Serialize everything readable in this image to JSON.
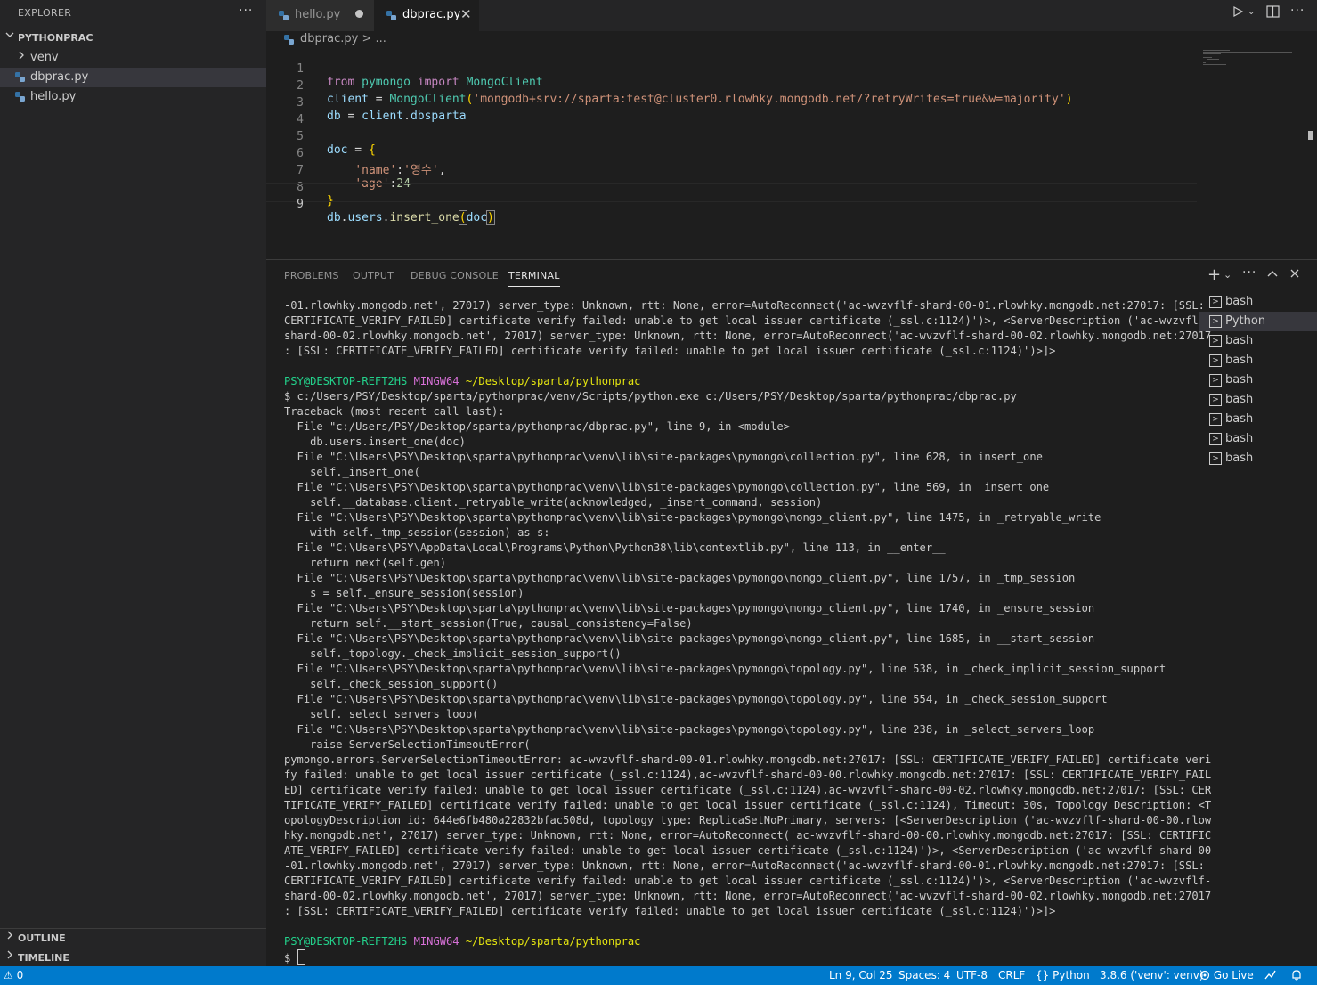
{
  "explorer": {
    "title": "EXPLORER",
    "more": "···",
    "folder": "PYTHONPRAC",
    "items": [
      {
        "label": "venv",
        "type": "folder"
      },
      {
        "label": "dbprac.py",
        "type": "file",
        "active": true
      },
      {
        "label": "hello.py",
        "type": "file"
      }
    ],
    "outline": "OUTLINE",
    "timeline": "TIMELINE"
  },
  "tabs": [
    {
      "label": "hello.py",
      "state": "modified"
    },
    {
      "label": "dbprac.py",
      "state": "active"
    }
  ],
  "breadcrumb": {
    "file": "dbprac.py",
    "rest": "> ..."
  },
  "editor": {
    "line_numbers": [
      "1",
      "2",
      "3",
      "4",
      "5",
      "6",
      "7",
      "8",
      "9"
    ],
    "lines": {
      "l1": {
        "kw1": "from",
        "mod": "pymongo",
        "kw2": "import",
        "cls": "MongoClient"
      },
      "l2": {
        "var": "client",
        "op": " = ",
        "cls": "MongoClient",
        "open": "(",
        "str": "'mongodb+srv://sparta:test@cluster0.rlowhky.mongodb.net/?retryWrites=true&w=majority'",
        "close": ")"
      },
      "l3": {
        "var": "db",
        "op": " = ",
        "v2": "client",
        "dot": ".",
        "attr": "dbsparta"
      },
      "l5": {
        "var": "doc",
        "op": " = ",
        "brace": "{"
      },
      "l6": {
        "key": "'name'",
        "colon": ":",
        "val": "'영수'",
        "comma": ","
      },
      "l7": {
        "key": "'age'",
        "colon": ":",
        "val": "24"
      },
      "l8": {
        "brace": "}"
      },
      "l9": {
        "v1": "db",
        "dot1": ".",
        "v2": "users",
        "dot2": ".",
        "fn": "insert_one",
        "open": "(",
        "arg": "doc",
        "close": ")"
      }
    }
  },
  "panel": {
    "tabs": [
      "PROBLEMS",
      "OUTPUT",
      "DEBUG CONSOLE",
      "TERMINAL"
    ],
    "active_tab": "TERMINAL",
    "actions": {
      "add": "+",
      "chev": "⌄",
      "more": "···",
      "maximize": "^",
      "close": "✕"
    }
  },
  "terminal": {
    "head": [
      "-01.rlowhky.mongodb.net', 27017) server_type: Unknown, rtt: None, error=AutoReconnect('ac-wvzvflf-shard-00-01.rlowhky.mongodb.net:27017: [SSL:",
      "CERTIFICATE_VERIFY_FAILED] certificate verify failed: unable to get local issuer certificate (_ssl.c:1124)')>, <ServerDescription ('ac-wvzvflf-",
      "shard-00-02.rlowhky.mongodb.net', 27017) server_type: Unknown, rtt: None, error=AutoReconnect('ac-wvzvflf-shard-00-02.rlowhky.mongodb.net:27017",
      ": [SSL: CERTIFICATE_VERIFY_FAILED] certificate verify failed: unable to get local issuer certificate (_ssl.c:1124)')>]>"
    ],
    "prompt": {
      "user": "PSY@DESKTOP-REFT2HS",
      "shell": "MINGW64",
      "path": "~/Desktop/sparta/pythonprac"
    },
    "command": "$ c:/Users/PSY/Desktop/sparta/pythonprac/venv/Scripts/python.exe c:/Users/PSY/Desktop/sparta/pythonprac/dbprac.py",
    "trace": [
      "Traceback (most recent call last):",
      "  File \"c:/Users/PSY/Desktop/sparta/pythonprac/dbprac.py\", line 9, in <module>",
      "    db.users.insert_one(doc)",
      "  File \"C:\\Users\\PSY\\Desktop\\sparta\\pythonprac\\venv\\lib\\site-packages\\pymongo\\collection.py\", line 628, in insert_one",
      "    self._insert_one(",
      "  File \"C:\\Users\\PSY\\Desktop\\sparta\\pythonprac\\venv\\lib\\site-packages\\pymongo\\collection.py\", line 569, in _insert_one",
      "    self.__database.client._retryable_write(acknowledged, _insert_command, session)",
      "  File \"C:\\Users\\PSY\\Desktop\\sparta\\pythonprac\\venv\\lib\\site-packages\\pymongo\\mongo_client.py\", line 1475, in _retryable_write",
      "    with self._tmp_session(session) as s:",
      "  File \"C:\\Users\\PSY\\AppData\\Local\\Programs\\Python\\Python38\\lib\\contextlib.py\", line 113, in __enter__",
      "    return next(self.gen)",
      "  File \"C:\\Users\\PSY\\Desktop\\sparta\\pythonprac\\venv\\lib\\site-packages\\pymongo\\mongo_client.py\", line 1757, in _tmp_session",
      "    s = self._ensure_session(session)",
      "  File \"C:\\Users\\PSY\\Desktop\\sparta\\pythonprac\\venv\\lib\\site-packages\\pymongo\\mongo_client.py\", line 1740, in _ensure_session",
      "    return self.__start_session(True, causal_consistency=False)",
      "  File \"C:\\Users\\PSY\\Desktop\\sparta\\pythonprac\\venv\\lib\\site-packages\\pymongo\\mongo_client.py\", line 1685, in __start_session",
      "    self._topology._check_implicit_session_support()",
      "  File \"C:\\Users\\PSY\\Desktop\\sparta\\pythonprac\\venv\\lib\\site-packages\\pymongo\\topology.py\", line 538, in _check_implicit_session_support",
      "    self._check_session_support()",
      "  File \"C:\\Users\\PSY\\Desktop\\sparta\\pythonprac\\venv\\lib\\site-packages\\pymongo\\topology.py\", line 554, in _check_session_support",
      "    self._select_servers_loop(",
      "  File \"C:\\Users\\PSY\\Desktop\\sparta\\pythonprac\\venv\\lib\\site-packages\\pymongo\\topology.py\", line 238, in _select_servers_loop",
      "    raise ServerSelectionTimeoutError(",
      "pymongo.errors.ServerSelectionTimeoutError: ac-wvzvflf-shard-00-01.rlowhky.mongodb.net:27017: [SSL: CERTIFICATE_VERIFY_FAILED] certificate veri",
      "fy failed: unable to get local issuer certificate (_ssl.c:1124),ac-wvzvflf-shard-00-00.rlowhky.mongodb.net:27017: [SSL: CERTIFICATE_VERIFY_FAIL",
      "ED] certificate verify failed: unable to get local issuer certificate (_ssl.c:1124),ac-wvzvflf-shard-00-02.rlowhky.mongodb.net:27017: [SSL: CER",
      "TIFICATE_VERIFY_FAILED] certificate verify failed: unable to get local issuer certificate (_ssl.c:1124), Timeout: 30s, Topology Description: <T",
      "opologyDescription id: 644e6fb480a22832bfac508d, topology_type: ReplicaSetNoPrimary, servers: [<ServerDescription ('ac-wvzvflf-shard-00-00.rlow",
      "hky.mongodb.net', 27017) server_type: Unknown, rtt: None, error=AutoReconnect('ac-wvzvflf-shard-00-00.rlowhky.mongodb.net:27017: [SSL: CERTIFIC",
      "ATE_VERIFY_FAILED] certificate verify failed: unable to get local issuer certificate (_ssl.c:1124)')>, <ServerDescription ('ac-wvzvflf-shard-00",
      "-01.rlowhky.mongodb.net', 27017) server_type: Unknown, rtt: None, error=AutoReconnect('ac-wvzvflf-shard-00-01.rlowhky.mongodb.net:27017: [SSL:",
      "CERTIFICATE_VERIFY_FAILED] certificate verify failed: unable to get local issuer certificate (_ssl.c:1124)')>, <ServerDescription ('ac-wvzvflf-",
      "shard-00-02.rlowhky.mongodb.net', 27017) server_type: Unknown, rtt: None, error=AutoReconnect('ac-wvzvflf-shard-00-02.rlowhky.mongodb.net:27017",
      ": [SSL: CERTIFICATE_VERIFY_FAILED] certificate verify failed: unable to get local issuer certificate (_ssl.c:1124)')>]>"
    ],
    "prompt2": {
      "user": "PSY@DESKTOP-REFT2HS",
      "shell": "MINGW64",
      "path": "~/Desktop/sparta/pythonprac"
    },
    "input_prompt": "$ "
  },
  "terminal_list": [
    "bash",
    "Python",
    "bash",
    "bash",
    "bash",
    "bash",
    "bash",
    "bash",
    "bash"
  ],
  "status": {
    "remote": "⚠ 0",
    "position": "Ln 9, Col 25",
    "spaces": "Spaces: 4",
    "encoding": "UTF-8",
    "eol": "CRLF",
    "language": "Python",
    "interpreter": "3.8.6 ('venv': venv)",
    "golive": "Go Live"
  },
  "colors": {
    "statusbar": "#007acc",
    "sidebar": "#252526",
    "editor": "#1e1e1e",
    "prompt_green": "#23d18b",
    "prompt_magenta": "#d670d6",
    "prompt_yellow": "#e5e510"
  },
  "icons": [
    "python-file-icon",
    "chevron-right-icon",
    "chevron-down-icon",
    "close-icon",
    "run-icon",
    "split-editor-icon",
    "more-icon",
    "terminal-icon",
    "plus-icon",
    "maximize-icon",
    "broadcast-icon",
    "feedback-icon",
    "bell-icon"
  ]
}
